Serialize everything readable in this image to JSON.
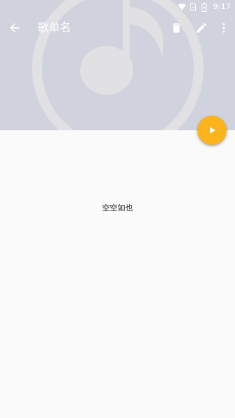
{
  "status_bar": {
    "time": "9:17",
    "icons": [
      "wifi-icon",
      "sim-icon",
      "battery-icon"
    ]
  },
  "toolbar": {
    "title": "歌单名",
    "icons": [
      "back-arrow-icon",
      "delete-icon",
      "edit-icon",
      "more-vert-icon"
    ]
  },
  "header": {
    "background_color": "#d0d3de",
    "artwork_icon": "music-note-icon",
    "artwork_color": "#e0e0e0"
  },
  "fab": {
    "icon": "play-icon",
    "color": "#fbb41b"
  },
  "content": {
    "empty_text": "空空如也",
    "background_color": "#fafafa"
  }
}
